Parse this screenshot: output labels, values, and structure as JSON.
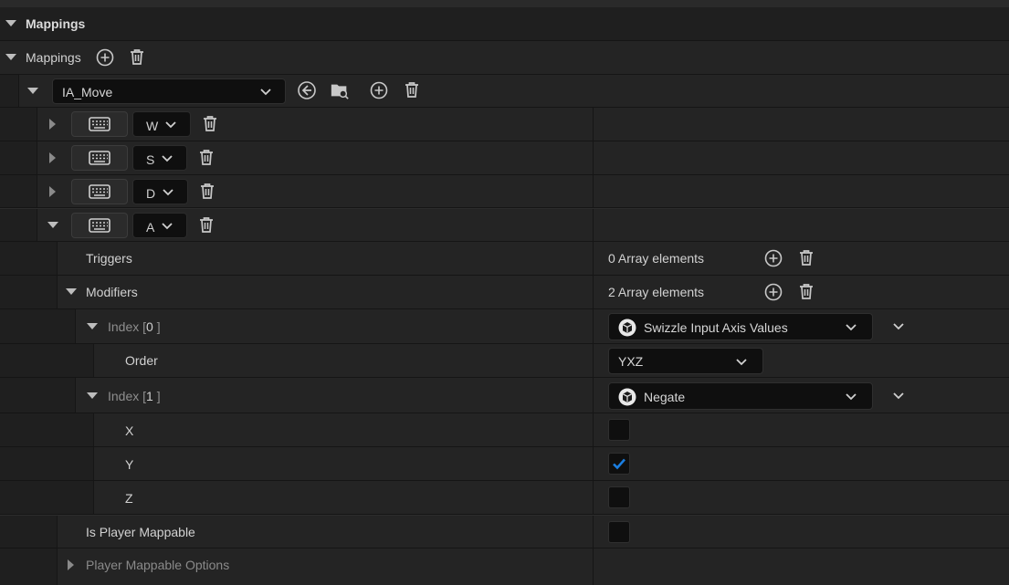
{
  "header": {
    "title": "Mappings"
  },
  "mappings": {
    "label": "Mappings"
  },
  "action": {
    "value": "IA_Move"
  },
  "keys": [
    {
      "key": "W"
    },
    {
      "key": "S"
    },
    {
      "key": "D"
    },
    {
      "key": "A"
    }
  ],
  "triggers": {
    "label": "Triggers",
    "count_text": "0 Array elements"
  },
  "modifiers": {
    "label": "Modifiers",
    "count_text": "2 Array elements",
    "index0": {
      "label_prefix": "Index [",
      "index": "0",
      "label_suffix": " ]",
      "value": "Swizzle Input Axis Values"
    },
    "order": {
      "label": "Order",
      "value": "YXZ"
    },
    "index1": {
      "label_prefix": "Index [",
      "index": "1",
      "label_suffix": " ]",
      "value": "Negate"
    },
    "x": {
      "label": "X",
      "checked": false
    },
    "y": {
      "label": "Y",
      "checked": true
    },
    "z": {
      "label": "Z",
      "checked": false
    }
  },
  "player_mappable": {
    "label": "Is Player Mappable",
    "checked": false
  },
  "player_mappable_options": {
    "label": "Player Mappable Options"
  },
  "colors": {
    "accent": "#1b7ee0",
    "bg_row": "#242424",
    "bg_panel": "#1a1a1a"
  }
}
